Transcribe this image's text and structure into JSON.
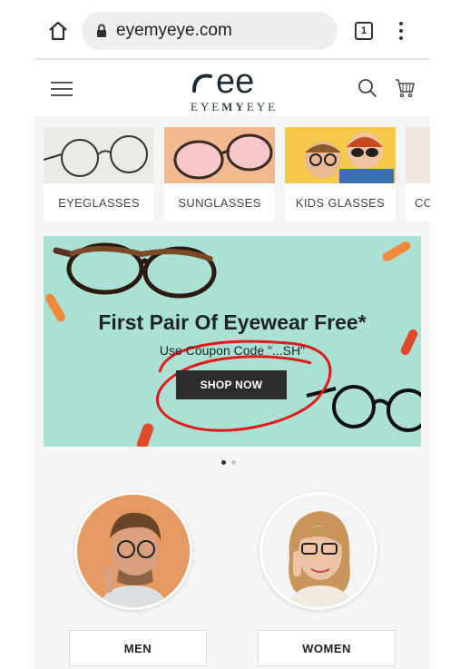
{
  "browser": {
    "url": "eyemyeye.com",
    "tab_count": "1"
  },
  "header": {
    "logo_mark": "ee",
    "logo_text_left": "EYE",
    "logo_text_mid": "MY",
    "logo_text_right": "EYE"
  },
  "categories": [
    {
      "label": "EYEGLASSES"
    },
    {
      "label": "SUNGLASSES"
    },
    {
      "label": "KIDS GLASSES"
    },
    {
      "label": "CC"
    }
  ],
  "banner": {
    "title": "First Pair Of Eyewear Free*",
    "subtitle": "Use Coupon Code \"...SH\"",
    "cta_label": "SHOP NOW",
    "bg_color": "#abe1d5"
  },
  "carousel": {
    "active_index": 0,
    "count": 2
  },
  "gender": [
    {
      "label": "MEN"
    },
    {
      "label": "WOMEN"
    }
  ]
}
